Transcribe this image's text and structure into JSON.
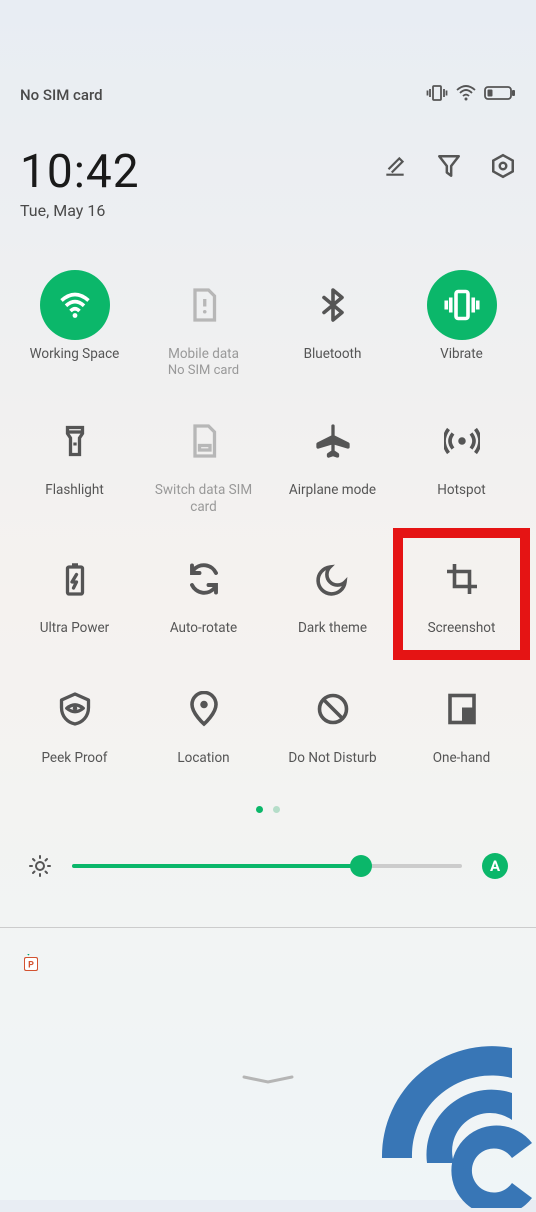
{
  "status": {
    "sim": "No SIM card"
  },
  "clock": {
    "time": "10:42",
    "date": "Tue, May 16"
  },
  "tiles": [
    {
      "label": "Working Space",
      "sub": "",
      "icon": "wifi-icon",
      "active": true
    },
    {
      "label": "Mobile data",
      "sub": "No SIM card",
      "icon": "sim-icon",
      "active": false,
      "disabled": true
    },
    {
      "label": "Bluetooth",
      "sub": "",
      "icon": "bluetooth-icon",
      "active": false
    },
    {
      "label": "Vibrate",
      "sub": "",
      "icon": "vibrate-icon",
      "active": true
    },
    {
      "label": "Flashlight",
      "sub": "",
      "icon": "flashlight-icon",
      "active": false
    },
    {
      "label": "Switch data SIM card",
      "sub": "",
      "icon": "switch-sim-icon",
      "active": false,
      "disabled": true
    },
    {
      "label": "Airplane mode",
      "sub": "",
      "icon": "airplane-icon",
      "active": false
    },
    {
      "label": "Hotspot",
      "sub": "",
      "icon": "hotspot-icon",
      "active": false
    },
    {
      "label": "Ultra Power",
      "sub": "",
      "icon": "battery-icon",
      "active": false
    },
    {
      "label": "Auto-rotate",
      "sub": "",
      "icon": "rotate-icon",
      "active": false
    },
    {
      "label": "Dark theme",
      "sub": "",
      "icon": "moon-icon",
      "active": false
    },
    {
      "label": "Screenshot",
      "sub": "",
      "icon": "crop-icon",
      "active": false,
      "highlighted": true
    },
    {
      "label": "Peek Proof",
      "sub": "",
      "icon": "eye-shield-icon",
      "active": false
    },
    {
      "label": "Location",
      "sub": "",
      "icon": "location-icon",
      "active": false
    },
    {
      "label": "Do Not Disturb",
      "sub": "",
      "icon": "dnd-icon",
      "active": false
    },
    {
      "label": "One-hand",
      "sub": "",
      "icon": "onehand-icon",
      "active": false
    }
  ],
  "pager": {
    "current": 0,
    "total": 2
  },
  "brightness": {
    "value": 74,
    "auto_label": "A"
  },
  "colors": {
    "accent": "#0bb76a",
    "highlight": "#e51414"
  }
}
